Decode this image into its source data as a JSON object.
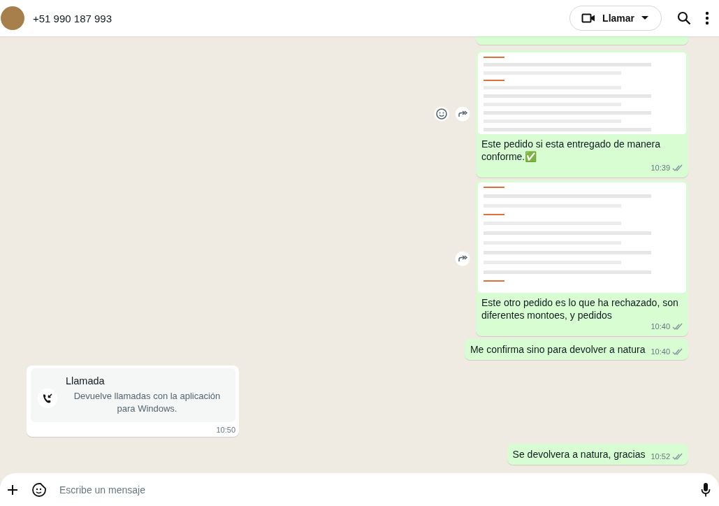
{
  "header": {
    "contact": "+51 990 187 993",
    "call_button": "Llamar"
  },
  "messages": [
    {
      "kind": "clipped",
      "outgoing": true
    },
    {
      "kind": "image",
      "outgoing": true,
      "text": "Este pedido si esta entregado de manera conforme.✅",
      "time": "10:39",
      "read": false,
      "emoji_button": true
    },
    {
      "kind": "image",
      "outgoing": true,
      "text": "Este otro pedido es lo que ha rechazado, son diferentes montoes, y pedidos",
      "time": "10:40",
      "read": false,
      "emoji_button": false
    },
    {
      "kind": "text",
      "outgoing": true,
      "text": "Me confirma sino para devolver a natura",
      "time": "10:40",
      "read": false
    },
    {
      "kind": "call",
      "outgoing": false,
      "title": "Llamada",
      "text": "Devuelve llamadas con la aplicación para Windows.",
      "time": "10:50"
    },
    {
      "kind": "text",
      "outgoing": true,
      "text": "Se devolvera a natura, gracias",
      "time": "10:52",
      "read": false
    }
  ],
  "composer": {
    "placeholder": "Escribe un mensaje"
  }
}
